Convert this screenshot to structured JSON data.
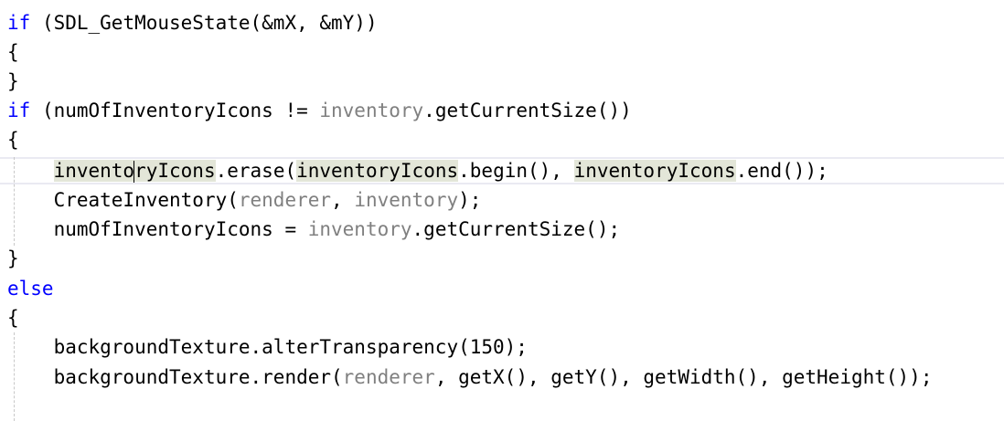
{
  "code": {
    "l1": {
      "kw": "if",
      "rest": " (SDL_GetMouseState(&mX, &mY))"
    },
    "l2": {
      "text": "{"
    },
    "l3": {
      "text": "}"
    },
    "l4": {
      "kw": "if",
      "a": " (numOfInventoryIcons != ",
      "p": "inventory",
      "b": ".getCurrentSize())"
    },
    "l5": {
      "text": "{"
    },
    "l6": {
      "indent": "    ",
      "hl1a": "invento",
      "hl1b": "ryIcons",
      "a": ".erase(",
      "hl2": "inventoryIcons",
      "b": ".begin(), ",
      "hl3": "inventoryIcons",
      "c": ".end());"
    },
    "l7": {
      "indent": "    ",
      "a": "CreateInventory(",
      "p1": "renderer",
      "b": ", ",
      "p2": "inventory",
      "c": ");"
    },
    "l8": {
      "indent": "    ",
      "a": "numOfInventoryIcons = ",
      "p": "inventory",
      "b": ".getCurrentSize();"
    },
    "l9": {
      "text": "}"
    },
    "l10": {
      "kw": "else"
    },
    "l11": {
      "text": "{"
    },
    "l12": {
      "indent": "    ",
      "text": "backgroundTexture.alterTransparency(150);"
    },
    "l13": {
      "indent": "    ",
      "a": "backgroundTexture.render(",
      "p": "renderer",
      "b": ", getX(), getY(), getWidth(), getHeight());"
    }
  },
  "colors": {
    "keyword": "#0000ff",
    "parameter": "#808080",
    "reference_highlight": "#e3e6d8",
    "current_line_border": "#eaeaf2",
    "indent_guide": "#c8c8c8"
  }
}
